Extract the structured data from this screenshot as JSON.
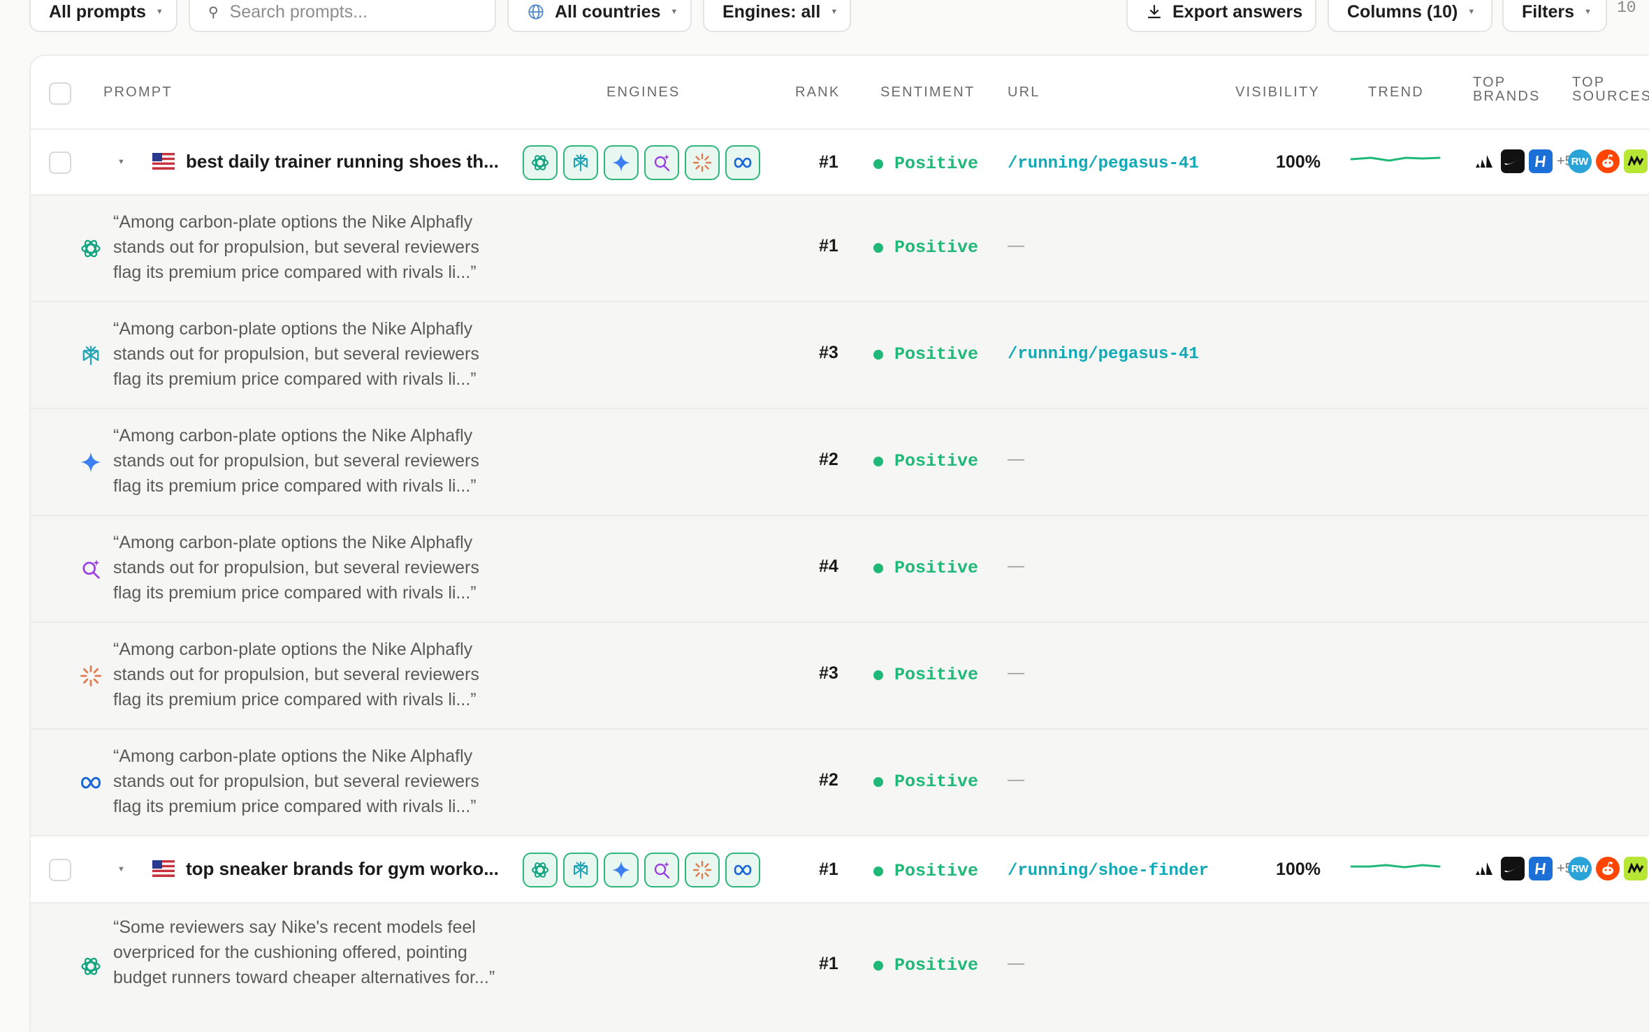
{
  "toolbar": {
    "prompts_filter": "All prompts",
    "search_placeholder": "Search prompts...",
    "countries_filter": "All countries",
    "engines_filter": "Engines: all",
    "export_label": "Export answers",
    "columns_label": "Columns (10)",
    "filters_label": "Filters",
    "count": "10"
  },
  "columns": {
    "prompt": "PROMPT",
    "engines": "ENGINES",
    "rank": "RANK",
    "sentiment": "SENTIMENT",
    "url": "URL",
    "visibility": "VISIBILITY",
    "trend": "TREND",
    "top_brands_1": "TOP",
    "top_brands_2": "BRANDS",
    "top_sources_1": "TOP",
    "top_sources_2": "SOURCES"
  },
  "engines": [
    "chatgpt-icon",
    "perplexity-icon",
    "gemini-icon",
    "copilot-icon",
    "claude-icon",
    "meta-ai-icon"
  ],
  "colors": {
    "accent_green": "#1fb877",
    "url_teal": "#12a9b7",
    "chip_border": "#2fb67a"
  },
  "prompts": [
    {
      "text": "best daily trainer running shoes th...",
      "rank": "#1",
      "sentiment": "Positive",
      "url": "/running/pegasus-41",
      "visibility": "100%",
      "brands_more": "+5",
      "answers": [
        {
          "engine": "chatgpt-icon",
          "quote": "“Among carbon-plate options the Nike Alphafly stands out for propulsion, but several reviewers flag its premium price compared with rivals li...”",
          "rank": "#1",
          "sentiment": "Positive",
          "url": "—"
        },
        {
          "engine": "perplexity-icon",
          "quote": "“Among carbon-plate options the Nike Alphafly stands out for propulsion, but several reviewers flag its premium price compared with rivals li...”",
          "rank": "#3",
          "sentiment": "Positive",
          "url": "/running/pegasus-41"
        },
        {
          "engine": "gemini-icon",
          "quote": "“Among carbon-plate options the Nike Alphafly stands out for propulsion, but several reviewers flag its premium price compared with rivals li...”",
          "rank": "#2",
          "sentiment": "Positive",
          "url": "—"
        },
        {
          "engine": "copilot-icon",
          "quote": "“Among carbon-plate options the Nike Alphafly stands out for propulsion, but several reviewers flag its premium price compared with rivals li...”",
          "rank": "#4",
          "sentiment": "Positive",
          "url": "—"
        },
        {
          "engine": "claude-icon",
          "quote": "“Among carbon-plate options the Nike Alphafly stands out for propulsion, but several reviewers flag its premium price compared with rivals li...”",
          "rank": "#3",
          "sentiment": "Positive",
          "url": "—"
        },
        {
          "engine": "meta-ai-icon",
          "quote": "“Among carbon-plate options the Nike Alphafly stands out for propulsion, but several reviewers flag its premium price compared with rivals li...”",
          "rank": "#2",
          "sentiment": "Positive",
          "url": "—"
        }
      ]
    },
    {
      "text": "top sneaker brands for gym worko...",
      "rank": "#1",
      "sentiment": "Positive",
      "url": "/running/shoe-finder",
      "visibility": "100%",
      "brands_more": "+5",
      "answers": [
        {
          "engine": "chatgpt-icon",
          "quote": "“Some reviewers say Nike's recent models feel overpriced for the cushioning offered, pointing budget runners toward cheaper alternatives for...”",
          "rank": "#1",
          "sentiment": "Positive",
          "url": "—"
        }
      ]
    }
  ]
}
